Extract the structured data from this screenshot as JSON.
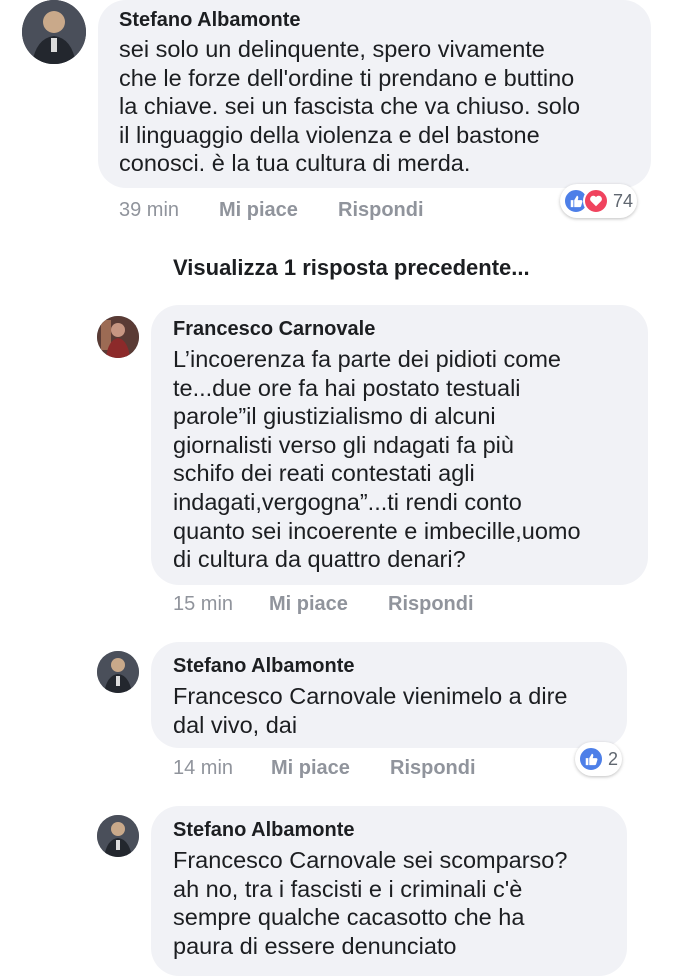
{
  "comments": [
    {
      "author": "Stefano Albamonte",
      "text": "sei solo un delinquente, spero vivamente\nche le forze dell'ordine ti prendano e buttino\nla chiave. sei un fascista che va chiuso. solo\nil linguaggio della violenza e del bastone\nconosci. è la tua cultura di merda.",
      "time": "39 min",
      "like_label": "Mi piace",
      "reply_label": "Rispondi",
      "reactions": {
        "icons": [
          "like-icon",
          "love-icon"
        ],
        "count": "74"
      }
    },
    {
      "author": "Francesco Carnovale",
      "text": "L’incoerenza fa parte dei pidioti come\nte...due ore fa hai postato testuali\nparole”il giustizialismo di alcuni\ngiornalisti verso gli ndagati fa più\nschifo dei reati contestati agli\nindagati,vergogna”...ti rendi conto\nquanto sei incoerente e imbecille,uomo\ndi cultura da quattro denari?",
      "time": "15 min",
      "like_label": "Mi piace",
      "reply_label": "Rispondi"
    },
    {
      "author": "Stefano Albamonte",
      "text": "Francesco Carnovale vienimelo a dire\ndal vivo, dai",
      "time": "14 min",
      "like_label": "Mi piace",
      "reply_label": "Rispondi",
      "reactions": {
        "icons": [
          "like-icon"
        ],
        "count": "2"
      }
    },
    {
      "author": "Stefano Albamonte",
      "text": "Francesco Carnovale sei scomparso?\nah no, tra i fascisti e i criminali c'è\nsempre qualche cacasotto che ha\npaura di essere denunciato"
    }
  ],
  "previous_replies_label": "Visualizza 1 risposta precedente...",
  "colors": {
    "bubble": "#f1f2f6",
    "meta": "#90949c",
    "like": "#4d7fe8",
    "love": "#f0435e"
  }
}
